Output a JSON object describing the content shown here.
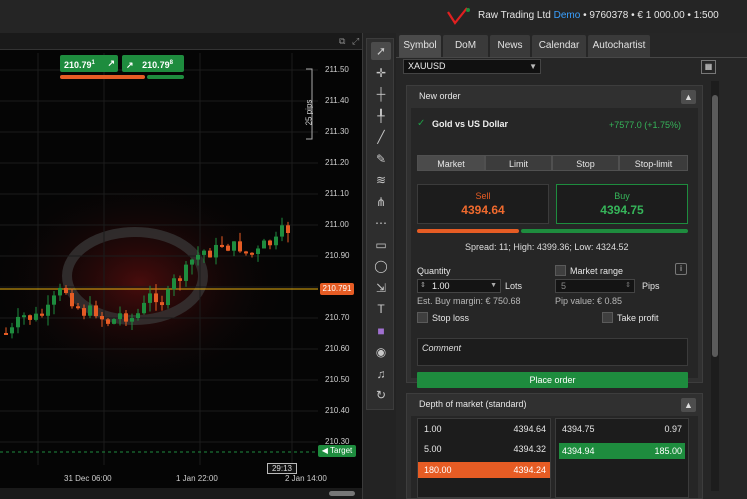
{
  "account": {
    "broker": "Raw Trading Ltd",
    "separator": " • ",
    "mode": "Demo",
    "number": "9760378",
    "balance": "€ 1 000.00",
    "leverage": "1:500"
  },
  "chart": {
    "quick_sell": "210.79",
    "quick_sell_sup": "1",
    "quick_buy": "210.79",
    "quick_buy_sup": "8",
    "price_levels": [
      "211.50",
      "211.40",
      "211.30",
      "211.20",
      "211.10",
      "211.00",
      "210.90",
      "210.80",
      "210.70",
      "210.60",
      "210.50",
      "210.40",
      "210.30"
    ],
    "current_price": "210.791",
    "target_label": "Target",
    "pips_label": "25 pips",
    "timer": "29:13",
    "time_labels": [
      "31 Dec 06:00",
      "1 Jan 22:00",
      "2 Jan 14:00"
    ],
    "colors": {
      "up": "#1e8c3e",
      "down": "#e65c24",
      "background": "#050505"
    }
  },
  "toolbar": {
    "tools": [
      "cursor-icon",
      "crosshair-icon",
      "horizontal-line-icon",
      "vertical-line-icon",
      "trend-line-icon",
      "pencil-icon",
      "fibonacci-icon",
      "pitchfork-icon",
      "dotted-lines-icon",
      "rectangle-icon",
      "ellipse-icon",
      "measure-icon",
      "text-icon",
      "color-square-icon",
      "camera-icon",
      "alert-icon",
      "replay-icon"
    ]
  },
  "tabs": [
    "Symbol",
    "DoM",
    "News",
    "Calendar",
    "Autochartist"
  ],
  "active_tab": "Symbol",
  "symbol_select": {
    "value": "XAUUSD"
  },
  "new_order": {
    "title": "New order",
    "symbol_name": "Gold vs US Dollar",
    "change": "+7577.0 (+1.75%)",
    "order_tabs": [
      "Market",
      "Limit",
      "Stop",
      "Stop-limit"
    ],
    "active_order_tab": "Market",
    "sell": {
      "label": "Sell",
      "price": "4394.64"
    },
    "buy": {
      "label": "Buy",
      "price": "4394.75"
    },
    "spread_info": "Spread: 11; High: 4399.36; Low: 4324.52",
    "quantity_label": "Quantity",
    "quantity_value": "1.00",
    "quantity_unit": "Lots",
    "market_range_label": "Market range",
    "market_range_value": "5",
    "market_range_unit": "Pips",
    "est_margin": "Est. Buy margin: € 750.68",
    "pip_value": "Pip value: € 0.85",
    "stop_loss_label": "Stop loss",
    "take_profit_label": "Take profit",
    "comment_placeholder": "Comment",
    "place_order_label": "Place order",
    "info_icon": "i"
  },
  "depth_of_market": {
    "title": "Depth of market (standard)",
    "sell_rows": [
      {
        "volume": "1.00",
        "price": "4394.64"
      },
      {
        "volume": "5.00",
        "price": "4394.32"
      },
      {
        "volume": "180.00",
        "price": "4394.24"
      }
    ],
    "buy_rows": [
      {
        "price": "4394.75",
        "volume": "0.97"
      },
      {
        "price": "4394.94",
        "volume": "185.00"
      }
    ]
  }
}
